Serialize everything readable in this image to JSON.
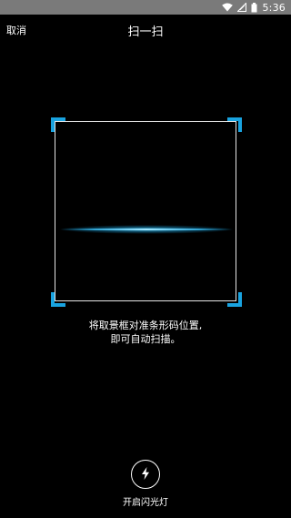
{
  "status_bar": {
    "time": "5:36",
    "icons": [
      "wifi-icon",
      "signal-icon",
      "battery-icon"
    ]
  },
  "header": {
    "cancel_label": "取消",
    "title": "扫一扫"
  },
  "scanner": {
    "accent_color": "#19a3e0",
    "hint_line1": "将取景框对准条形码位置,",
    "hint_line2": "即可自动扫描。"
  },
  "flashlight": {
    "icon": "flash-icon",
    "label": "开启闪光灯"
  }
}
